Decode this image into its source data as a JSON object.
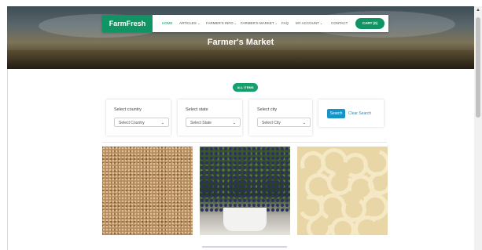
{
  "navbar": {
    "brand": "FarmFresh",
    "items": [
      {
        "label": "HOME",
        "active": true,
        "dropdown": false
      },
      {
        "label": "ARTICLES",
        "dropdown": true
      },
      {
        "label": "FARMER'S INFO",
        "dropdown": true
      },
      {
        "label": "FARMER'S MARKET",
        "dropdown": true
      },
      {
        "label": "FAQ",
        "dropdown": false
      },
      {
        "label": "MY ACCOUNT",
        "dropdown": true
      },
      {
        "label": "CONTACT",
        "dropdown": false
      }
    ],
    "cart_label": "CART (0)",
    "accent": "#119463"
  },
  "hero": {
    "title": "Farmer's Market"
  },
  "all_items_label": "ALL ITEMS",
  "filters": {
    "country": {
      "label": "Select country",
      "value": "Select Country"
    },
    "state": {
      "label": "Select state",
      "value": "Select State"
    },
    "city": {
      "label": "Select city",
      "value": "Select City"
    }
  },
  "search": {
    "button_label": "Search",
    "clear_label": "Clear Search",
    "button_color": "#1693c9"
  },
  "products": [
    {
      "image": "grain-image"
    },
    {
      "image": "blueberry-plant-image"
    },
    {
      "image": "cashew-image"
    }
  ]
}
